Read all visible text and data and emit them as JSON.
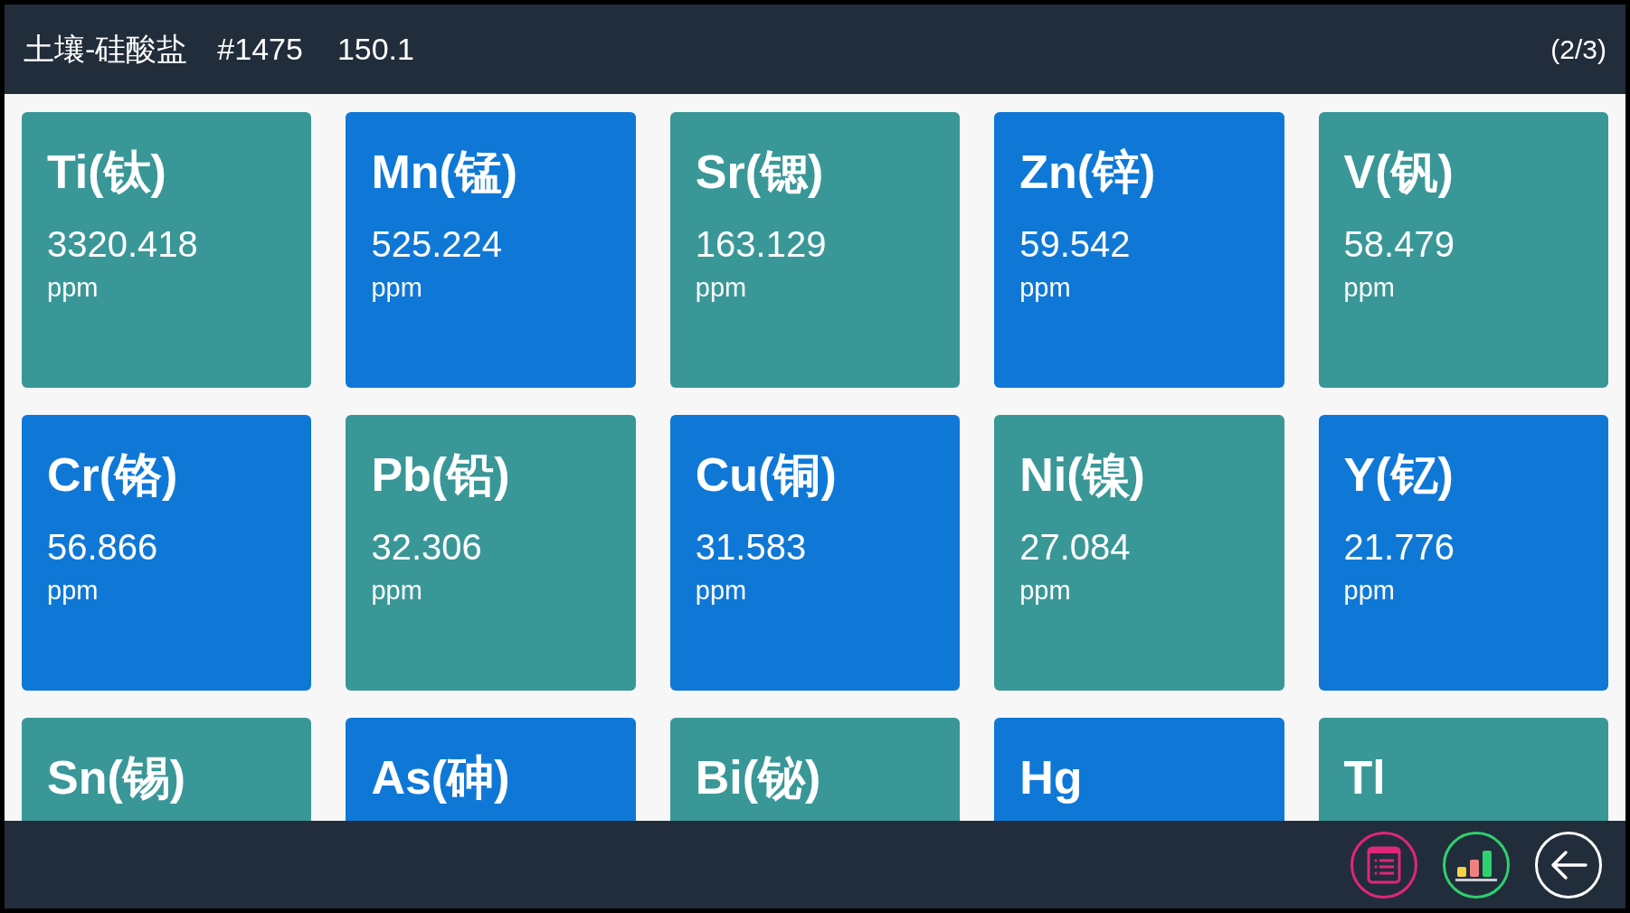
{
  "header": {
    "title": "土壤-硅酸盐",
    "sample": "#1475",
    "value": "150.1",
    "page": "(2/3)"
  },
  "tiles": [
    {
      "element": "Ti(钛)",
      "value": "3320.418",
      "unit": "ppm",
      "color": "#3a9797"
    },
    {
      "element": "Mn(锰)",
      "value": "525.224",
      "unit": "ppm",
      "color": "#0f78d7"
    },
    {
      "element": "Sr(锶)",
      "value": "163.129",
      "unit": "ppm",
      "color": "#3a9797"
    },
    {
      "element": "Zn(锌)",
      "value": "59.542",
      "unit": "ppm",
      "color": "#0f78d7"
    },
    {
      "element": "V(钒)",
      "value": "58.479",
      "unit": "ppm",
      "color": "#3a9797"
    },
    {
      "element": "Cr(铬)",
      "value": "56.866",
      "unit": "ppm",
      "color": "#0f78d7"
    },
    {
      "element": "Pb(铅)",
      "value": "32.306",
      "unit": "ppm",
      "color": "#3a9797"
    },
    {
      "element": "Cu(铜)",
      "value": "31.583",
      "unit": "ppm",
      "color": "#0f78d7"
    },
    {
      "element": "Ni(镍)",
      "value": "27.084",
      "unit": "ppm",
      "color": "#3a9797"
    },
    {
      "element": "Y(钇)",
      "value": "21.776",
      "unit": "ppm",
      "color": "#0f78d7"
    },
    {
      "element": "Sn(锡)",
      "color": "#3a9797"
    },
    {
      "element": "As(砷)",
      "color": "#0f78d7"
    },
    {
      "element": "Bi(铋)",
      "color": "#3a9797"
    },
    {
      "element": "Hg",
      "color": "#0f78d7"
    },
    {
      "element": "Tl",
      "color": "#3a9797"
    }
  ]
}
